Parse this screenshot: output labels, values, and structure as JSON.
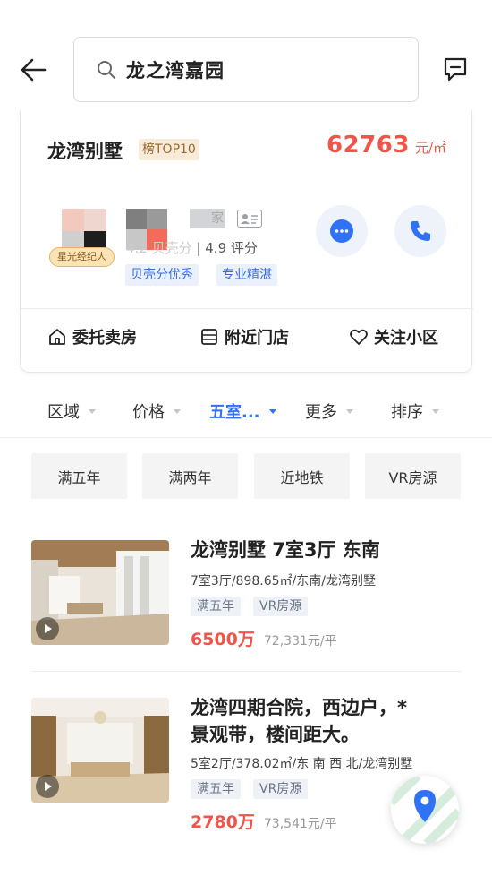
{
  "search": {
    "query": "龙之湾嘉园"
  },
  "community": {
    "name": "龙湾别墅",
    "rank_badge": "榜TOP10",
    "price_value": "62763",
    "price_unit": "元/㎡",
    "agent": {
      "badge": "星光经纪人",
      "rating_hidden": "4.2",
      "rating_blurred": "贝壳分",
      "rating_text": "| 4.9 评分",
      "tags": [
        "贝壳分优秀",
        "专业精湛"
      ]
    },
    "actions": [
      "委托卖房",
      "附近门店",
      "关注小区"
    ]
  },
  "filters": [
    {
      "label": "区域",
      "active": false
    },
    {
      "label": "价格",
      "active": false
    },
    {
      "label": "五室...",
      "active": true
    },
    {
      "label": "更多",
      "active": false
    },
    {
      "label": "排序",
      "active": false
    }
  ],
  "quick_tags": [
    "满五年",
    "满两年",
    "近地铁",
    "VR房源"
  ],
  "listings": [
    {
      "title": "龙湾别墅 7室3厅 东南",
      "detail": "7室3厅/898.65㎡/东南/龙湾别墅",
      "tags": [
        "满五年",
        "VR房源"
      ],
      "total_price": "6500万",
      "unit_price": "72,331元/平"
    },
    {
      "title": "龙湾四期合院，西边户，* 景观带，楼间距大。",
      "title_line1": "龙湾四期合院，西边户，*",
      "title_line2": "景观带，楼间距大。",
      "detail": "5室2厅/378.02㎡/东 南 西 北/龙湾别墅",
      "tags": [
        "满五年",
        "VR房源"
      ],
      "total_price": "2780万",
      "unit_price": "73,541元/平"
    }
  ],
  "colors": {
    "accent_blue": "#3072f6",
    "price_red": "#f0554b",
    "badge_gold": "#9a6a32"
  },
  "icons": [
    "back-arrow-icon",
    "search-icon",
    "message-icon",
    "chat-bubble-icon",
    "phone-icon",
    "house-icon",
    "store-icon",
    "heart-icon",
    "map-pin-icon",
    "vr-play-icon"
  ]
}
